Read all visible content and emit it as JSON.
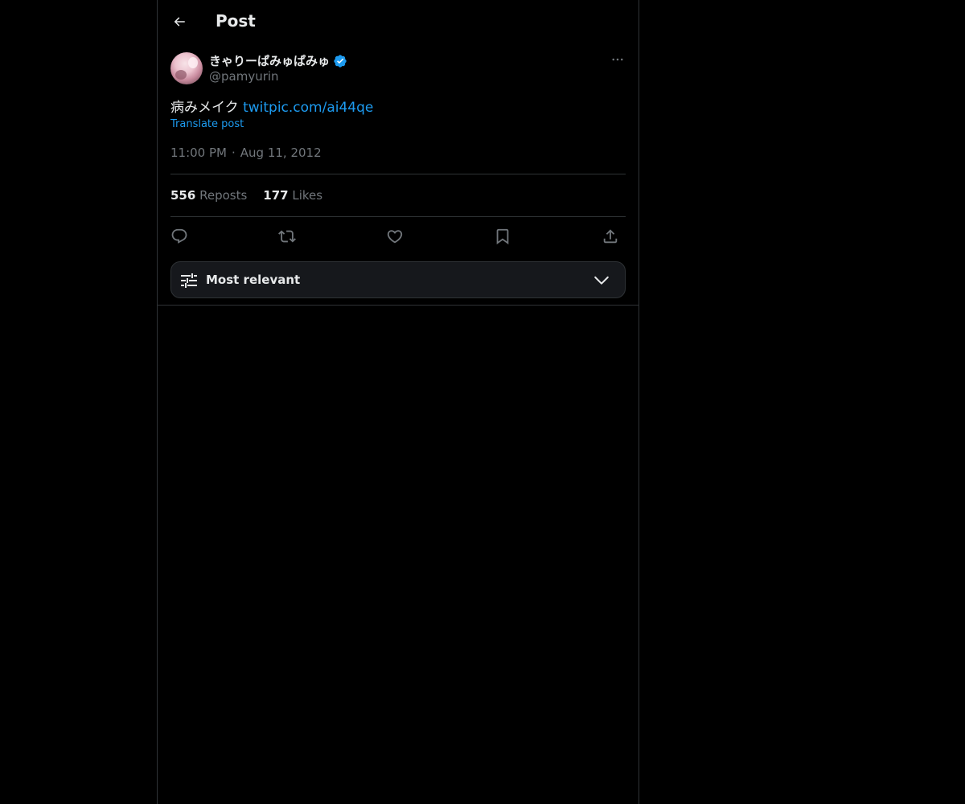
{
  "header": {
    "title": "Post"
  },
  "author": {
    "display_name": "きゃりーぱみゅぱみゅ",
    "handle": "@pamyurin",
    "verified": true
  },
  "tweet": {
    "text": "病みメイク ",
    "link": "twitpic.com/ai44qe",
    "translate_label": "Translate post",
    "time": "11:00 PM",
    "separator": "·",
    "date": "Aug 11, 2012"
  },
  "stats": {
    "reposts_count": "556",
    "reposts_label": "Reposts",
    "likes_count": "177",
    "likes_label": "Likes"
  },
  "sort": {
    "label": "Most relevant"
  },
  "colors": {
    "background": "#000000",
    "text": "#e7e9ea",
    "muted": "#71767b",
    "accent": "#1d9bf0",
    "border": "#2f3336"
  },
  "icons": [
    "back-arrow-icon",
    "verified-badge-icon",
    "more-icon",
    "reply-icon",
    "repost-icon",
    "like-icon",
    "bookmark-icon",
    "share-icon",
    "sliders-icon",
    "chevron-down-icon"
  ]
}
